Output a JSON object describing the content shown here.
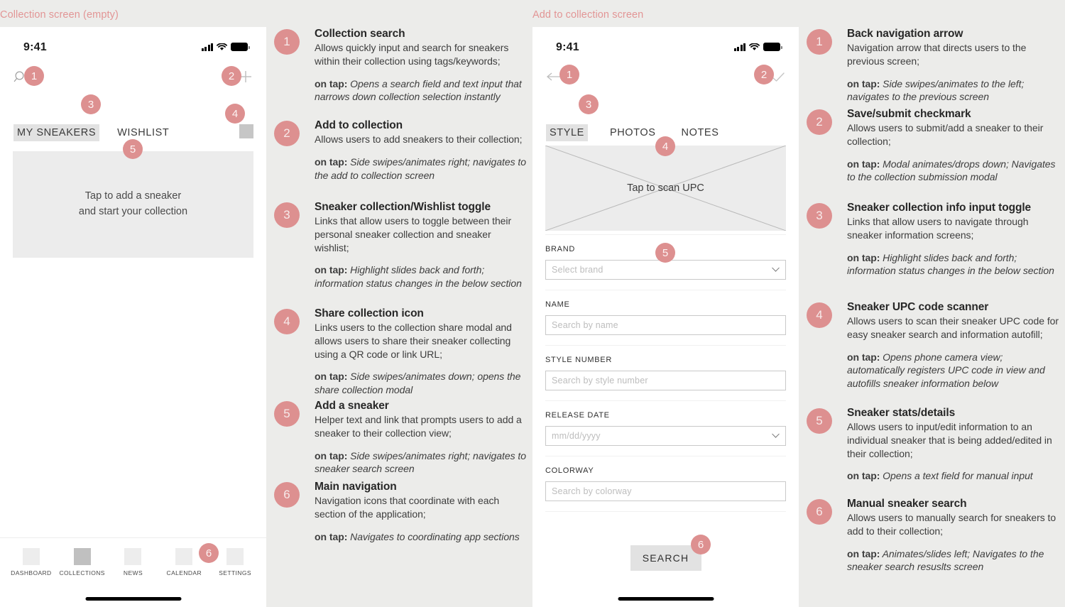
{
  "screens": {
    "left": {
      "label": "Collection screen (empty)",
      "status": {
        "time": "9:41"
      },
      "icons": {
        "search": "search-icon",
        "add": "plus-icon",
        "share": "share-square-icon"
      },
      "tabs": [
        {
          "label": "MY SNEAKERS",
          "active": true
        },
        {
          "label": "WISHLIST",
          "active": false
        }
      ],
      "empty_state": {
        "line1": "Tap to add a sneaker",
        "line2": "and start your collection"
      },
      "bottom_nav": [
        {
          "label": "DASHBOARD",
          "active": false
        },
        {
          "label": "COLLECTIONS",
          "active": true
        },
        {
          "label": "NEWS",
          "active": false
        },
        {
          "label": "CALENDAR",
          "active": false
        },
        {
          "label": "SETTINGS",
          "active": false
        }
      ],
      "badges": [
        "1",
        "2",
        "3",
        "4",
        "5",
        "6"
      ]
    },
    "right": {
      "label": "Add to collection screen",
      "status": {
        "time": "9:41"
      },
      "icons": {
        "back": "back-arrow-icon",
        "save": "checkmark-icon"
      },
      "tabs": [
        {
          "label": "STYLE",
          "active": true
        },
        {
          "label": "PHOTOS",
          "active": false
        },
        {
          "label": "NOTES",
          "active": false
        }
      ],
      "upc_scanner": {
        "label": "Tap to scan UPC"
      },
      "fields": [
        {
          "label": "BRAND",
          "placeholder": "Select brand",
          "type": "select"
        },
        {
          "label": "NAME",
          "placeholder": "Search by name",
          "type": "text"
        },
        {
          "label": "STYLE NUMBER",
          "placeholder": "Search by style number",
          "type": "text"
        },
        {
          "label": "RELEASE DATE",
          "placeholder": "mm/dd/yyyy",
          "type": "select"
        },
        {
          "label": "COLORWAY",
          "placeholder": "Search by colorway",
          "type": "text"
        }
      ],
      "search_button": {
        "label": "SEARCH"
      },
      "badges": [
        "1",
        "2",
        "3",
        "4",
        "5",
        "6"
      ]
    }
  },
  "annotations": {
    "middle": [
      {
        "num": "1",
        "title": "Collection search",
        "desc": "Allows quickly input and search for sneakers within their collection using tags/keywords;",
        "tap_label": "on tap:",
        "tap": "Opens a search field and text input that narrows down collection selection instantly"
      },
      {
        "num": "2",
        "title": "Add to collection",
        "desc": "Allows users to add sneakers to their collection;",
        "tap_label": "on tap:",
        "tap": "Side swipes/animates right; navigates to the add to collection screen"
      },
      {
        "num": "3",
        "title": "Sneaker collection/Wishlist toggle",
        "desc": "Links that allow users to toggle between their personal sneaker collection and sneaker wishlist;",
        "tap_label": "on tap:",
        "tap": "Highlight slides back and forth; information status changes in the below section"
      },
      {
        "num": "4",
        "title": "Share collection icon",
        "desc": "Links users to the collection share modal and allows users to share their sneaker collecting using a QR code or link URL;",
        "tap_label": "on tap:",
        "tap": "Side swipes/animates down; opens the share collection modal"
      },
      {
        "num": "5",
        "title": "Add a sneaker",
        "desc": "Helper text and link that prompts users to add a sneaker to their collection view;",
        "tap_label": "on tap:",
        "tap": "Side swipes/animates right; navigates to sneaker search screen"
      },
      {
        "num": "6",
        "title": "Main navigation",
        "desc": "Navigation icons that coordinate with each section of the application;",
        "tap_label": "on tap:",
        "tap": "Navigates to coordinating app sections"
      }
    ],
    "right": [
      {
        "num": "1",
        "title": "Back navigation arrow",
        "desc": "Navigation arrow that directs users to the previous screen;",
        "tap_label": "on tap:",
        "tap": "Side swipes/animates to the left; navigates to the previous screen"
      },
      {
        "num": "2",
        "title": "Save/submit checkmark",
        "desc": "Allows users to submit/add a sneaker to their collection;",
        "tap_label": "on tap:",
        "tap": "Modal animates/drops down; Navigates to the collection submission modal"
      },
      {
        "num": "3",
        "title": "Sneaker collection info input toggle",
        "desc": "Links that allow users to navigate through sneaker information screens;",
        "tap_label": "on tap:",
        "tap": "Highlight slides back and forth; information status changes in the below section"
      },
      {
        "num": "4",
        "title": "Sneaker UPC code scanner",
        "desc": "Allows users to scan their sneaker UPC code for easy sneaker search and information autofill;",
        "tap_label": "on tap:",
        "tap": "Opens phone camera view; automatically registers UPC code in view and autofills sneaker information below"
      },
      {
        "num": "5",
        "title": "Sneaker stats/details",
        "desc": "Allows users to input/edit information to an individual sneaker that is being added/edited in their collection;",
        "tap_label": "on tap:",
        "tap": "Opens a text field for manual input"
      },
      {
        "num": "6",
        "title": "Manual sneaker search",
        "desc": "Allows users to manually search for sneakers to add to their collection;",
        "tap_label": "on tap:",
        "tap": "Animates/slides left; Navigates to the sneaker search resuslts screen"
      }
    ]
  },
  "colors": {
    "accent": "#dd9090",
    "page_bg": "#ececea",
    "phone_bg": "#ffffff",
    "placeholder_gray": "#ececec"
  }
}
